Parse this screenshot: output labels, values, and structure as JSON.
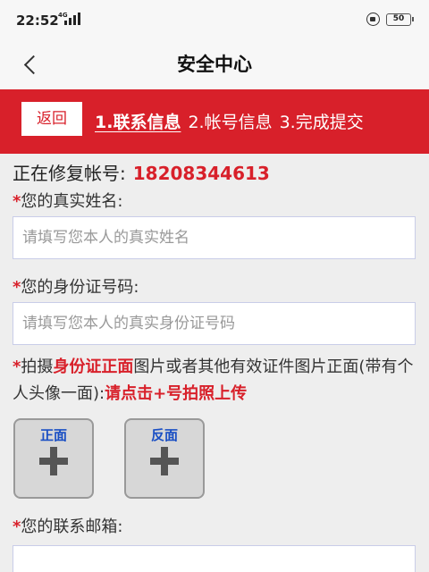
{
  "status_bar": {
    "time": "22:52",
    "network": "4G",
    "battery": "50"
  },
  "nav": {
    "title": "安全中心"
  },
  "steps": {
    "back_label": "返回",
    "step1": "1.联系信息",
    "step2": "2.帐号信息",
    "step3": "3.完成提交"
  },
  "form": {
    "repair_prefix": "正在修复帐号:",
    "account_number": "18208344613",
    "required_mark": "*",
    "name_label": "您的真实姓名:",
    "name_placeholder": "请填写您本人的真实姓名",
    "id_label": "您的身份证号码:",
    "id_placeholder": "请填写您本人的真实身份证号码",
    "photo_prefix": "拍摄",
    "photo_highlight": "身份证正面",
    "photo_middle": "图片或者其他有效证件图片正面(带有个人头像一面):",
    "photo_instruction": "请点击+号拍照上传",
    "front_label": "正面",
    "back_label": "反面",
    "email_label": "您的联系邮箱:"
  },
  "colors": {
    "accent_red": "#d8202a",
    "upload_caption_blue": "#1a4fc4"
  }
}
